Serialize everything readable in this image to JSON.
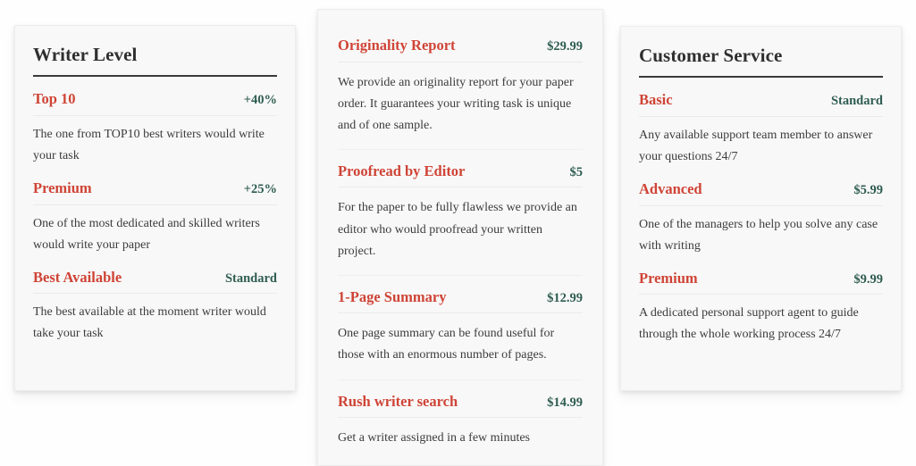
{
  "theme": {
    "page_background": "#fefefe",
    "card_background": "#f8f8f8",
    "accent_red": "#cf4436",
    "value_green": "#2f5d51",
    "title_color": "#2f2f2f",
    "body_color": "#3c3c3c"
  },
  "cards": [
    {
      "id": "writer-level",
      "title": "Writer Level",
      "options": [
        {
          "name": "Top 10",
          "value": "+40%",
          "description": "The one from TOP10 best writers would write your task"
        },
        {
          "name": "Premium",
          "value": "+25%",
          "description": "One of the most dedicated and skilled writers would write your paper"
        },
        {
          "name": "Best Available",
          "value": "Standard",
          "description": "The best available at the moment writer would take your task"
        }
      ]
    },
    {
      "id": "add-ons",
      "title": "",
      "options": [
        {
          "name": "Originality Report",
          "value": "$29.99",
          "description": "We provide an originality report for your paper order. It guarantees your writing task is unique and of one sample."
        },
        {
          "name": "Proofread by Editor",
          "value": "$5",
          "description": "For the paper to be fully flawless we provide an editor who would proofread your written project."
        },
        {
          "name": "1-Page Summary",
          "value": "$12.99",
          "description": "One page summary can be found useful for those with an enormous number of pages."
        },
        {
          "name": "Rush writer search",
          "value": "$14.99",
          "description": "Get a writer assigned in a few minutes"
        }
      ]
    },
    {
      "id": "customer-service",
      "title": "Customer Service",
      "options": [
        {
          "name": "Basic",
          "value": "Standard",
          "description": "Any available support team member to answer your questions 24/7"
        },
        {
          "name": "Advanced",
          "value": "$5.99",
          "description": "One of the managers to help you solve any case with writing"
        },
        {
          "name": "Premium",
          "value": "$9.99",
          "description": "A dedicated personal support agent to guide through the whole working process 24/7"
        }
      ]
    }
  ]
}
